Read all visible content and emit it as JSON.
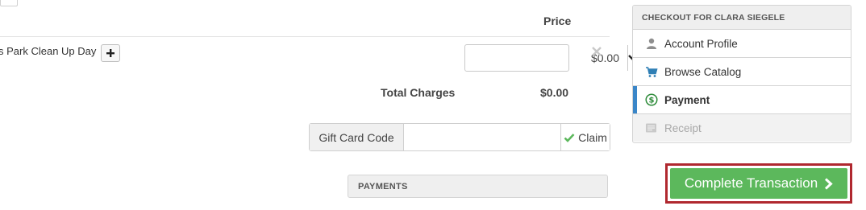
{
  "cart": {
    "price_header": "Price",
    "item_name": "s Park Clean Up Day",
    "item_price": "$0.00",
    "total_label": "Total Charges",
    "total_value": "$0.00"
  },
  "gift_card": {
    "label": "Gift Card Code",
    "value": "",
    "claim_label": "Claim"
  },
  "payments": {
    "header": "PAYMENTS"
  },
  "checkout": {
    "title": "CHECKOUT FOR CLARA SIEGELE",
    "steps": [
      {
        "label": "Account Profile",
        "icon": "user-icon",
        "state": "default"
      },
      {
        "label": "Browse Catalog",
        "icon": "cart-icon",
        "state": "default"
      },
      {
        "label": "Payment",
        "icon": "dollar-circle-icon",
        "state": "active"
      },
      {
        "label": "Receipt",
        "icon": "receipt-icon",
        "state": "disabled"
      }
    ],
    "complete_label": "Complete Transaction"
  },
  "colors": {
    "accent_green": "#5cb85c",
    "highlight_border": "#b0282f",
    "active_step": "#3a86c8"
  }
}
